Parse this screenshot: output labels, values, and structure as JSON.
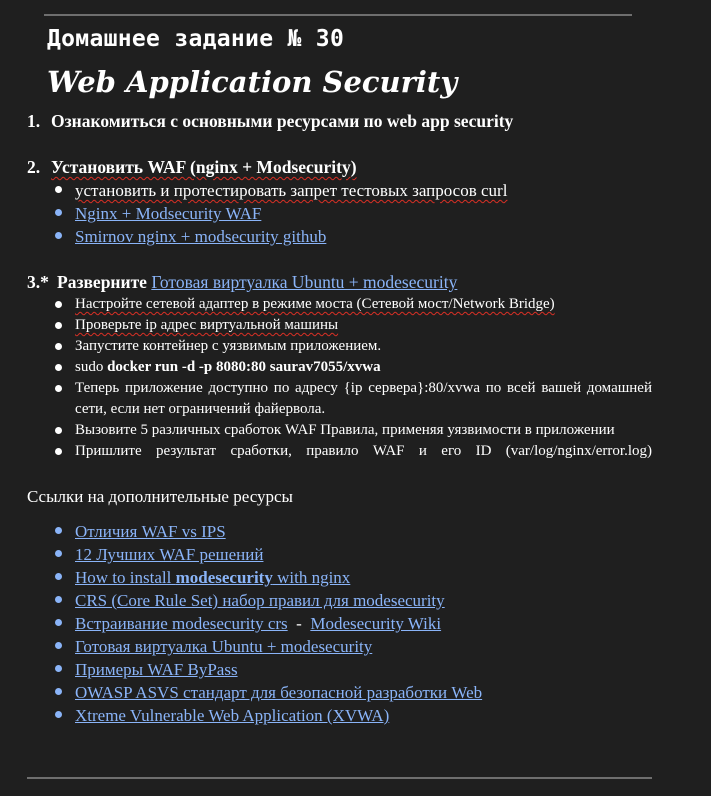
{
  "header": {
    "hw_title": "Домашнее задание № 30",
    "course_title": "Web Application Security"
  },
  "section1": {
    "num": "1.",
    "title": "Ознакомиться с основными ресурсами по web app security"
  },
  "section2": {
    "num": "2.",
    "title": "Установить WAF (nginx + Modsecurity)",
    "items": [
      "установить и протестировать запрет тестовых запросов curl"
    ],
    "links": [
      "Nginx + Modsecurity WAF",
      "Smirnov nginx + modsecurity github"
    ]
  },
  "section3": {
    "num": "3.*",
    "title_bold": "Разверните",
    "title_link": "Готовая виртуалка Ubuntu + modesecurity",
    "items": [
      "Настройте сетевой адаптер в режиме моста (Сетевой мост/Network Bridge)",
      "Проверьте ip адрес виртуальной машины",
      "Запустите контейнер с уязвимым приложением."
    ],
    "cmd_prefix": "sudo ",
    "cmd_bold": "docker run -d -p 8080:80 saurav7055/xvwa",
    "item_url": "Теперь приложение доступно по адресу {ip сервера}:80/xvwa по всей вашей домашней сети, если нет ограничений файервола.",
    "item_trigger": "Вызовите 5 различных сработок WAF Правила, применяя уязвимости в приложении",
    "item_send": "Пришлите результат сработки, правило WAF и его ID (var/log/nginx/error.log)"
  },
  "resources": {
    "heading": "Ссылки на дополнительные ресурсы",
    "links": [
      "Отличия WAF vs IPS",
      "12 Лучших WAF решений"
    ],
    "howto_pre": "How to install ",
    "howto_bold": "modesecurity",
    "howto_post": " with nginx",
    "crs": "CRS (Core Rule Set) набор правил для modesecurity",
    "embed_a": "Встраивание modesecurity crs",
    "embed_sep": "  -  ",
    "embed_b": "Modesecurity Wiki",
    "more_links": [
      "Готовая виртуалка Ubuntu + modesecurity",
      "Примеры WAF ByPass",
      "OWASP ASVS стандарт для безопасной разработки Web",
      "Xtreme Vulnerable Web Application (XVWA)"
    ]
  },
  "colors": {
    "background": "#1f1f1f",
    "text": "#ffffff",
    "link": "#8ab4f8",
    "rule": "#6e6e6e",
    "spellcheck": "#d93025"
  }
}
